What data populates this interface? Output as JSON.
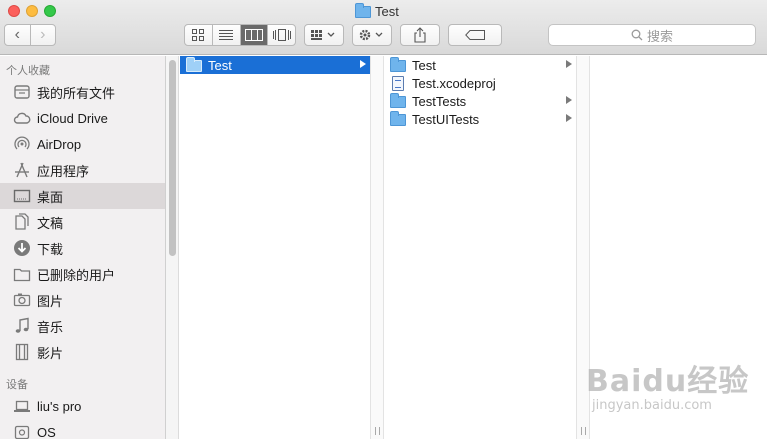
{
  "window": {
    "title": "Test"
  },
  "toolbar": {
    "back": "‹",
    "forward": "›",
    "search_placeholder": "搜索"
  },
  "sidebar": {
    "favorites_heading": "个人收藏",
    "favorites": [
      {
        "label": "我的所有文件",
        "icon": "all-files-icon"
      },
      {
        "label": "iCloud Drive",
        "icon": "cloud-icon"
      },
      {
        "label": "AirDrop",
        "icon": "airdrop-icon"
      },
      {
        "label": "应用程序",
        "icon": "applications-icon"
      },
      {
        "label": "桌面",
        "icon": "desktop-icon",
        "selected": true
      },
      {
        "label": "文稿",
        "icon": "documents-icon"
      },
      {
        "label": "下载",
        "icon": "downloads-icon"
      },
      {
        "label": "已删除的用户",
        "icon": "folder-icon"
      },
      {
        "label": "图片",
        "icon": "camera-icon"
      },
      {
        "label": "音乐",
        "icon": "music-icon"
      },
      {
        "label": "影片",
        "icon": "film-icon"
      }
    ],
    "devices_heading": "设备",
    "devices": [
      {
        "label": "liu's pro",
        "icon": "laptop-icon"
      },
      {
        "label": "OS",
        "icon": "disk-icon"
      }
    ]
  },
  "columns": {
    "col1": [
      {
        "label": "Test",
        "type": "folder",
        "selected": true
      }
    ],
    "col2": [
      {
        "label": "Test",
        "type": "folder"
      },
      {
        "label": "Test.xcodeproj",
        "type": "file"
      },
      {
        "label": "TestTests",
        "type": "folder"
      },
      {
        "label": "TestUITests",
        "type": "folder"
      }
    ]
  },
  "watermark": {
    "main": "Baidu经验",
    "sub": "jingyan.baidu.com"
  },
  "colors": {
    "selection": "#1a6fd6",
    "sidebar_bg": "#f2f0f1",
    "folder": "#6fb4ec"
  }
}
